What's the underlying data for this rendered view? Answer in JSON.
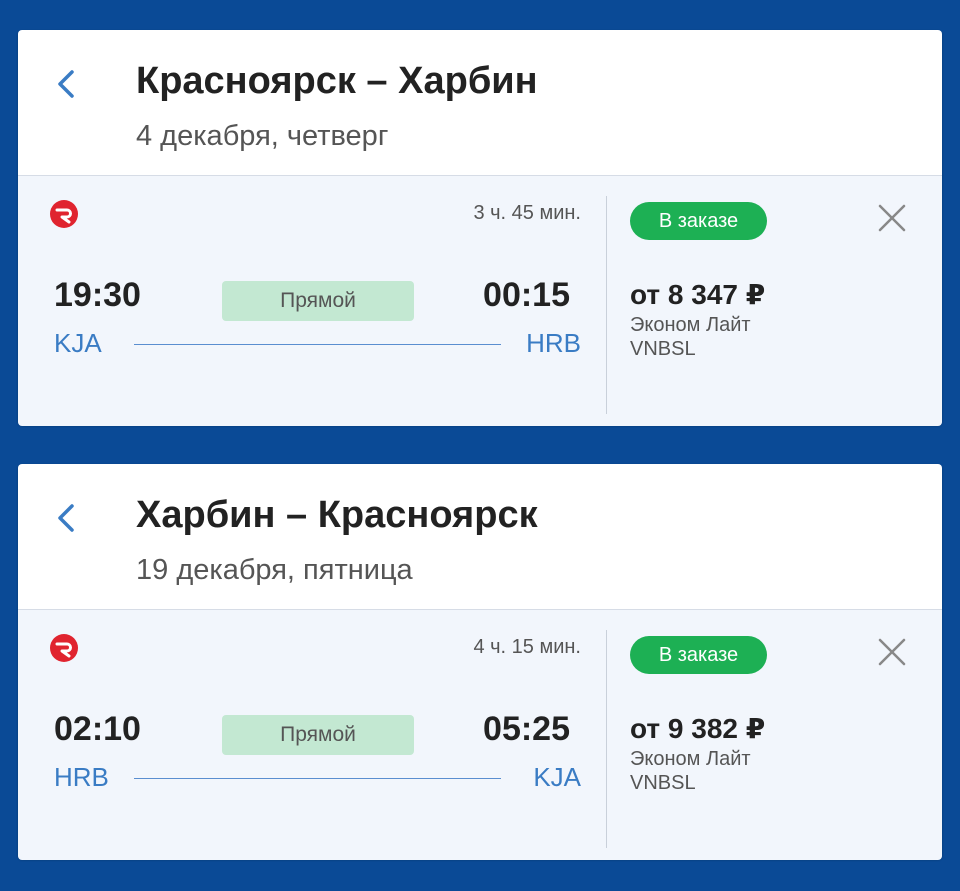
{
  "colors": {
    "background": "#0a4a96",
    "accent_blue": "#3a7cc4",
    "badge_green": "#1db054",
    "direct_bg": "#c3e8d2",
    "logo_red": "#e0242f"
  },
  "trips": [
    {
      "route_title": "Красноярск – Харбин",
      "date": "4 декабря, четверг",
      "back_icon": "chevron-left-icon",
      "flight": {
        "airline_icon": "airline-logo-icon",
        "duration": "3 ч. 45 мин.",
        "dep_time": "19:30",
        "arr_time": "00:15",
        "direct_label": "Прямой",
        "dep_code": "KJA",
        "arr_code": "HRB",
        "status_badge": "В заказе",
        "price": "от 8 347 ₽",
        "fare_name": "Эконом Лайт",
        "fare_code": "VNBSL",
        "close_icon": "close-icon"
      }
    },
    {
      "route_title": "Харбин – Красноярск",
      "date": "19 декабря, пятница",
      "back_icon": "chevron-left-icon",
      "flight": {
        "airline_icon": "airline-logo-icon",
        "duration": "4 ч. 15 мин.",
        "dep_time": "02:10",
        "arr_time": "05:25",
        "direct_label": "Прямой",
        "dep_code": "HRB",
        "arr_code": "KJA",
        "status_badge": "В заказе",
        "price": "от 9 382 ₽",
        "fare_name": "Эконом Лайт",
        "fare_code": "VNBSL",
        "close_icon": "close-icon"
      }
    }
  ]
}
